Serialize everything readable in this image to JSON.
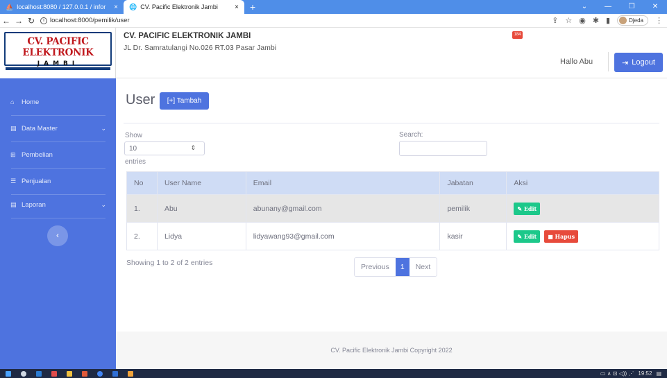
{
  "browser": {
    "tabs": [
      {
        "label": "localhost:8080 / 127.0.0.1 / infor",
        "close": "×"
      },
      {
        "label": "CV. Pacific Elektronik Jambi",
        "close": "×"
      }
    ],
    "new_tab": "+",
    "url": "localhost:8000/pemilik/user",
    "profile_name": "Djeda",
    "window_controls": {
      "minimize": "—",
      "restore": "❐",
      "close": "✕"
    }
  },
  "brand": {
    "line1": "CV. PACIFIC ELEKTRONIK",
    "line2": "JAMBI"
  },
  "header": {
    "company_name": "CV. PACIFIC ELEKTRONIK JAMBI",
    "company_address": "JL Dr. Samratulangi No.026 RT.03 Pasar Jambi",
    "notification_count": "184",
    "greeting": "Hallo Abu",
    "logout_label": "Logout"
  },
  "sidebar": {
    "items": [
      {
        "label": "Home",
        "icon": "home-icon"
      },
      {
        "label": "Data Master",
        "icon": "folder-icon",
        "expandable": true
      },
      {
        "label": "Pembelian",
        "icon": "cart-icon"
      },
      {
        "label": "Penjualan",
        "icon": "list-icon"
      },
      {
        "label": "Laporan",
        "icon": "folder-icon",
        "expandable": true
      }
    ],
    "toggle_icon": "chevron-left-icon"
  },
  "page": {
    "title": "User",
    "add_button": "[+] Tambah",
    "show_label": "Show",
    "entries_value": "10",
    "entries_label": "entries",
    "search_label": "Search:",
    "search_value": ""
  },
  "table": {
    "columns": [
      "No",
      "User Name",
      "Email",
      "Jabatan",
      "Aksi"
    ],
    "rows": [
      {
        "no": "1.",
        "username": "Abu",
        "email": "abunany@gmail.com",
        "jabatan": "pemilik",
        "actions": [
          "Edit"
        ]
      },
      {
        "no": "2.",
        "username": "Lidya",
        "email": "lidyawang93@gmail.com",
        "jabatan": "kasir",
        "actions": [
          "Edit",
          "Hapus"
        ]
      }
    ],
    "edit_label": "Edit",
    "delete_label": "Hapus"
  },
  "pagination": {
    "info": "Showing 1 to 2 of 2 entries",
    "previous": "Previous",
    "current": "1",
    "next": "Next"
  },
  "footer": {
    "text": "CV. Pacific Elektronik Jambi Copyright 2022"
  },
  "taskbar": {
    "time": "19:52"
  },
  "colors": {
    "primary": "#4e73df",
    "success": "#1cc88a",
    "danger": "#e74a3b",
    "logo_red": "#c0191e",
    "logo_blue": "#123b7a"
  }
}
